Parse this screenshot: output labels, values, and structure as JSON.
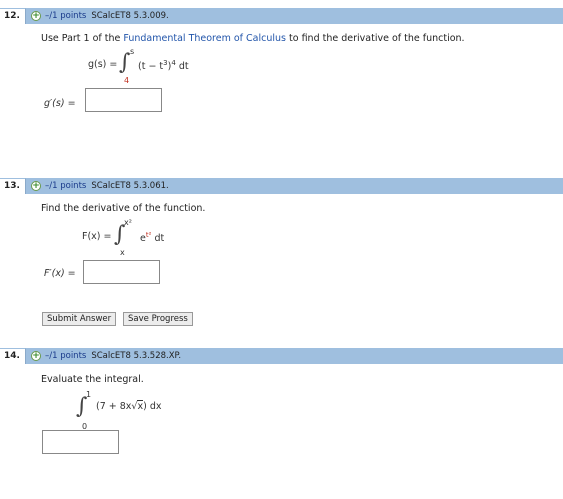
{
  "q12": {
    "number": "12.",
    "points": "–/1 points",
    "code": "SCalcET8 5.3.009.",
    "prompt_pre": "Use Part 1 of the ",
    "prompt_link": "Fundamental Theorem of Calculus",
    "prompt_post": " to find the derivative of the function.",
    "func_lhs": "g(s) =",
    "upper": "s",
    "lower": "4",
    "integrand": "(t − t",
    "exp1": "3",
    "integrand2": ")",
    "exp2": "4",
    "dt": " dt",
    "answer_label": "g′(s)  =",
    "answer_value": ""
  },
  "q13": {
    "number": "13.",
    "points": "–/1 points",
    "code": "SCalcET8 5.3.061.",
    "prompt": "Find the derivative of the function.",
    "func_lhs": "F(x) =",
    "upper": "x²",
    "lower": "x",
    "integrand": "e",
    "exp": "t²",
    "dt": " dt",
    "answer_label": "F′(x) =",
    "answer_value": "",
    "submit_label": "Submit Answer",
    "save_label": "Save Progress"
  },
  "q14": {
    "number": "14.",
    "points": "–/1 points",
    "code": "SCalcET8 5.3.528.XP.",
    "prompt": "Evaluate the integral.",
    "upper": "1",
    "lower": "0",
    "integrand_pre": "(7 + 8x",
    "sqrt_arg": "x",
    "integrand_post": ") dx",
    "answer_value": ""
  },
  "icons": {
    "plus": "+"
  },
  "colors": {
    "header_bg": "#9fbfdf",
    "link": "#2255aa",
    "points_text": "#1a3a8a"
  }
}
